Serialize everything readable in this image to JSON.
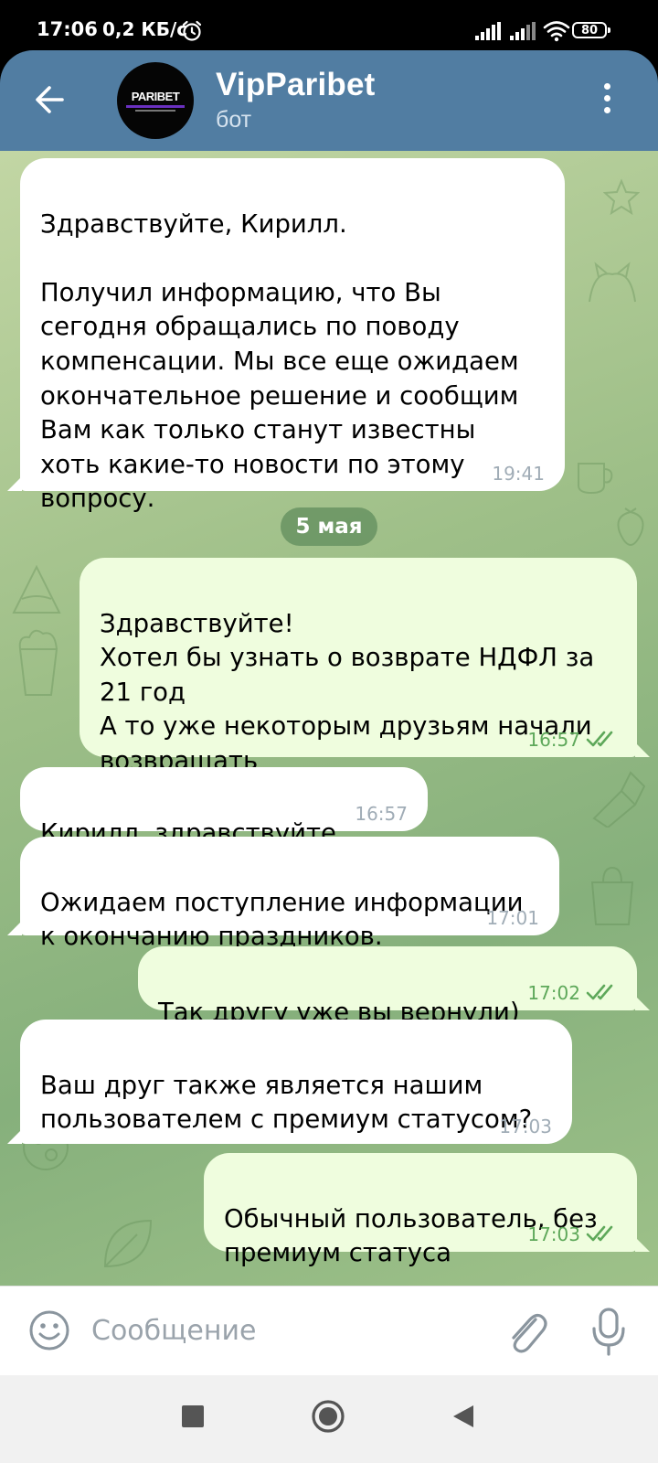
{
  "status_bar": {
    "time": "17:06",
    "speed": "0,2 КБ/с",
    "battery": "80",
    "alarm_icon": "alarm-clock-icon",
    "signal_icon": "cell-signal-icon",
    "wifi_icon": "wifi-icon"
  },
  "header": {
    "title": "VipParibet",
    "subtitle": "бот",
    "avatar_text": "PARIBET",
    "back_icon": "arrow-left-icon",
    "menu_icon": "more-vertical-icon",
    "bar_color": "#517da2"
  },
  "chat": {
    "date_separator": "5 мая",
    "incoming_color": "#ffffff",
    "outgoing_color": "#effdde",
    "read_icon": "double-check-icon",
    "messages": [
      {
        "direction": "in",
        "text": "Здравствуйте, Кирилл.\n\nПолучил информацию, что Вы\nсегодня обращались по поводу\nкомпенсации. Мы все еще ожидаем\nокончательное решение и сообщим\nВам как только станут известны\nхоть какие-то новости по этому\nвопросу.",
        "time": "19:41"
      },
      {
        "direction": "out",
        "text": "Здравствуйте!\nХотел бы узнать о возврате НДФЛ за\n21 год\nА то уже некоторым друзьям начали\nвозвращать",
        "time": "16:57",
        "read": true
      },
      {
        "direction": "in",
        "text": "Кирилл, здравствуйте",
        "time": "16:57"
      },
      {
        "direction": "in",
        "text": "Ожидаем поступление информации\nк окончанию праздников.",
        "time": "17:01"
      },
      {
        "direction": "out",
        "text": "Так другу уже вы вернули)",
        "time": "17:02",
        "read": true
      },
      {
        "direction": "in",
        "text": "Ваш друг также является нашим\nпользователем с премиум статусом?",
        "time": "17:03"
      },
      {
        "direction": "out",
        "text": "Обычный пользователь, без\nпремиум статуса",
        "time": "17:03",
        "read": true
      }
    ]
  },
  "composer": {
    "placeholder": "Сообщение",
    "emoji_icon": "smiley-icon",
    "attach_icon": "paperclip-icon",
    "mic_icon": "microphone-icon"
  },
  "nav_bar": {
    "recents_icon": "square-icon",
    "home_icon": "circle-icon",
    "back_icon": "triangle-back-icon"
  }
}
